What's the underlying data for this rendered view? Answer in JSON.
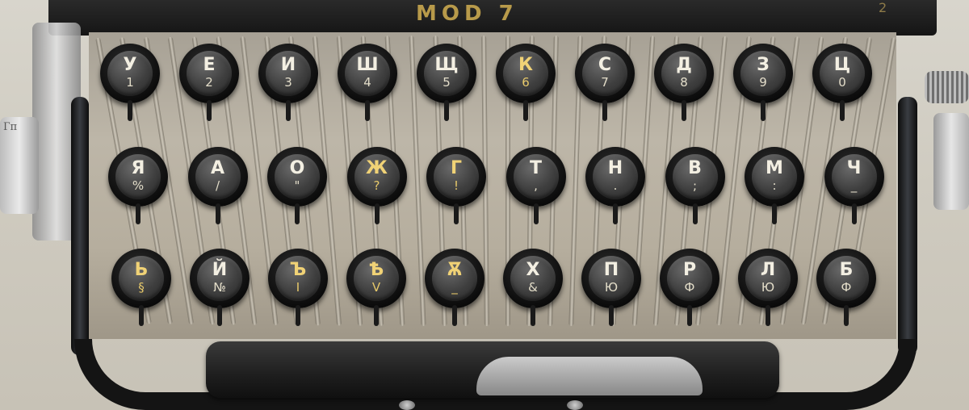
{
  "machine": {
    "model_label": "MOD 7",
    "corner_number": "2",
    "left_tab_text": "Гп"
  },
  "keyboard": {
    "rows": [
      [
        {
          "upper": "У",
          "lower": "1"
        },
        {
          "upper": "Е",
          "lower": "2"
        },
        {
          "upper": "И",
          "lower": "3"
        },
        {
          "upper": "Ш",
          "lower": "4"
        },
        {
          "upper": "Щ",
          "lower": "5"
        },
        {
          "upper": "К",
          "lower": "6"
        },
        {
          "upper": "С",
          "lower": "7"
        },
        {
          "upper": "Д",
          "lower": "8"
        },
        {
          "upper": "З",
          "lower": "9"
        },
        {
          "upper": "Ц",
          "lower": "0"
        }
      ],
      [
        {
          "upper": "Я",
          "lower": "%"
        },
        {
          "upper": "А",
          "lower": "/"
        },
        {
          "upper": "О",
          "lower": "\""
        },
        {
          "upper": "Ж",
          "lower": "?"
        },
        {
          "upper": "Г",
          "lower": "!"
        },
        {
          "upper": "Т",
          "lower": ","
        },
        {
          "upper": "Н",
          "lower": "."
        },
        {
          "upper": "В",
          "lower": ";"
        },
        {
          "upper": "М",
          "lower": ":"
        },
        {
          "upper": "Ч",
          "lower": "_"
        }
      ],
      [
        {
          "upper": "Ь",
          "lower": "§"
        },
        {
          "upper": "Й",
          "lower": "№"
        },
        {
          "upper": "Ъ",
          "lower": "I"
        },
        {
          "upper": "Ѣ",
          "lower": "V"
        },
        {
          "upper": "Ѫ",
          "lower": "_"
        },
        {
          "upper": "Х",
          "lower": "&"
        },
        {
          "upper": "П",
          "lower": "Ю"
        },
        {
          "upper": "Р",
          "lower": "Ф"
        },
        {
          "upper": "Л",
          "lower": "Ю"
        },
        {
          "upper": "Б",
          "lower": "Ф"
        }
      ]
    ]
  },
  "colors": {
    "key_text": "#f3efe2",
    "accent_text": "#f0d276",
    "model_label": "#b89a4a"
  }
}
